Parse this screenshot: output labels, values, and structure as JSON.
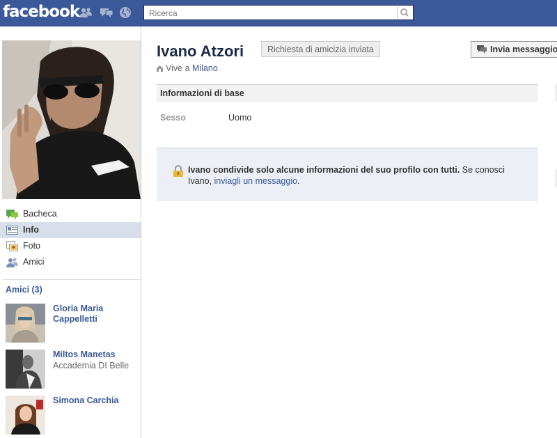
{
  "topbar": {
    "logo": "facebook",
    "search_placeholder": "Ricerca",
    "icons": [
      "friend-requests-icon",
      "messages-icon",
      "notifications-globe-icon",
      "search-icon"
    ],
    "colors": {
      "brand": "#3b5998",
      "link": "#3b5998"
    }
  },
  "profile": {
    "name": "Ivano Atzori",
    "friend_request_label": "Richiesta di amicizia inviata",
    "message_button_label": "Invia messaggio",
    "lives_prefix": "Vive a",
    "city": "Milano"
  },
  "sidebar": {
    "nav": [
      {
        "label": "Bacheca",
        "icon": "wall-icon",
        "active": false
      },
      {
        "label": "Info",
        "icon": "info-icon",
        "active": true
      },
      {
        "label": "Foto",
        "icon": "photos-icon",
        "active": false
      },
      {
        "label": "Amici",
        "icon": "friends-icon",
        "active": false
      }
    ],
    "friends_title": "Amici (3)",
    "friends": [
      {
        "name": "Gloria Maria Cappelletti",
        "subtitle": ""
      },
      {
        "name": "Miltos Manetas",
        "subtitle": "Accademia DI Belle"
      },
      {
        "name": "Simona Carchia",
        "subtitle": ""
      }
    ]
  },
  "info": {
    "section_title": "Informazioni di base",
    "fields": [
      {
        "label": "Sesso",
        "value": "Uomo"
      }
    ]
  },
  "notice": {
    "bold_text": "Ivano condivide solo alcune informazioni del suo profilo con tutti.",
    "text": " Se conosci Ivano, ",
    "link": "inviagli un messaggio",
    "end": "."
  }
}
